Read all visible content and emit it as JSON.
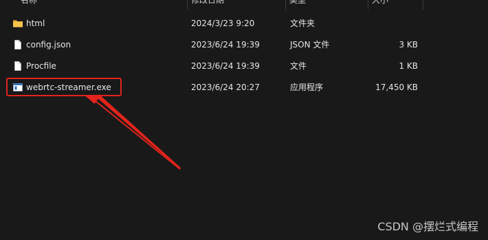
{
  "header": {
    "name": "名称",
    "modified": "修改日期",
    "type": "类型",
    "size": "大小"
  },
  "files": [
    {
      "name": "html",
      "modified": "2024/3/23 9:20",
      "type": "文件夹",
      "size": "",
      "icon": "folder-icon"
    },
    {
      "name": "config.json",
      "modified": "2023/6/24 19:39",
      "type": "JSON 文件",
      "size": "3 KB",
      "icon": "file-icon"
    },
    {
      "name": "Procfile",
      "modified": "2023/6/24 19:39",
      "type": "文件",
      "size": "1 KB",
      "icon": "file-icon"
    },
    {
      "name": "webrtc-streamer.exe",
      "modified": "2023/6/24 20:27",
      "type": "应用程序",
      "size": "17,450 KB",
      "icon": "exe-icon"
    }
  ],
  "annotation": {
    "color": "#e2241c"
  },
  "watermark": "CSDN @摆烂式编程"
}
